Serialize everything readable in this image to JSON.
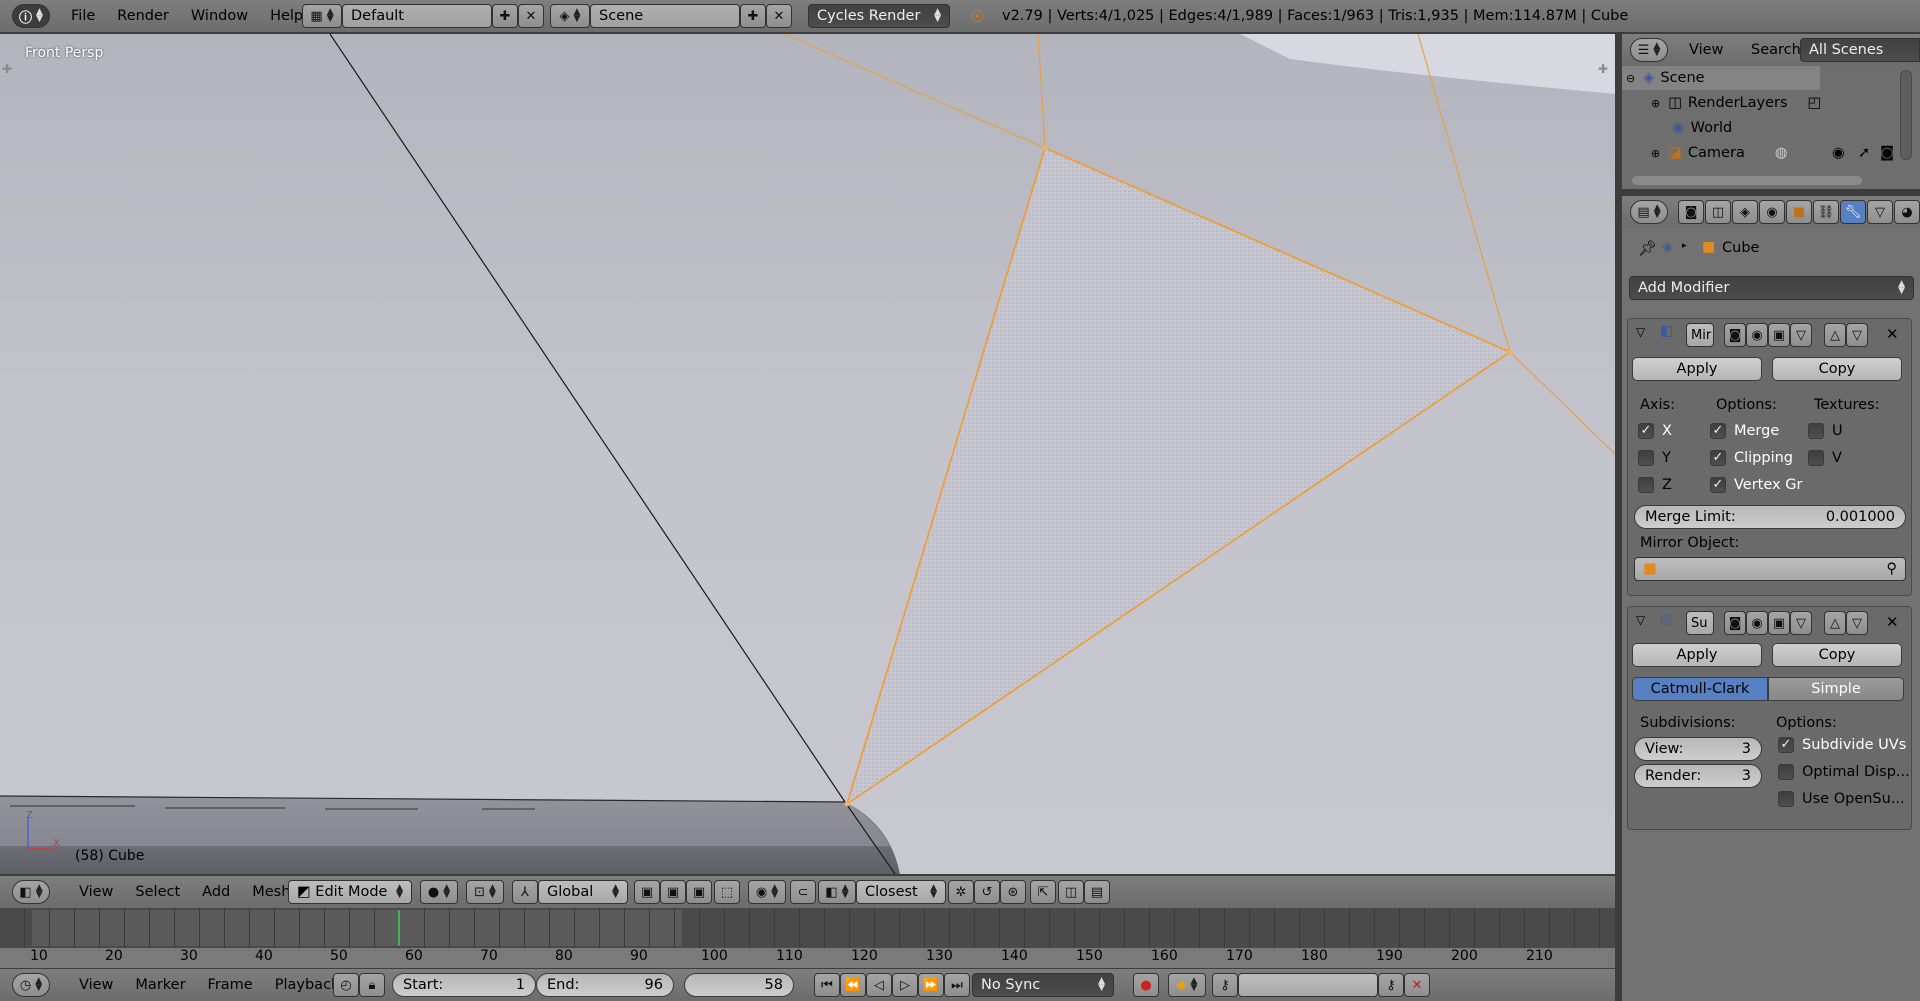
{
  "info_header": {
    "menus": [
      "File",
      "Render",
      "Window",
      "Help"
    ],
    "screen_layout": "Default",
    "scene": "Scene",
    "render_engine": "Cycles Render",
    "stats": "v2.79 | Verts:4/1,025 | Edges:4/1,989 | Faces:1/963 | Tris:1,935 | Mem:114.87M | Cube"
  },
  "viewport": {
    "view_label": "Front Persp",
    "object_label": "(58) Cube",
    "axis_z": "Z",
    "axis_x": "X"
  },
  "view3d_header": {
    "menus": [
      "View",
      "Select",
      "Add",
      "Mesh"
    ],
    "mode": "Edit Mode",
    "orientation": "Global",
    "snap_target": "Closest"
  },
  "timeline": {
    "ticks": [
      "10",
      "20",
      "30",
      "40",
      "50",
      "60",
      "70",
      "80",
      "90",
      "100",
      "110",
      "120",
      "130",
      "140",
      "150",
      "160",
      "170",
      "180",
      "190",
      "200",
      "210"
    ],
    "current_frame": 58,
    "menus": [
      "View",
      "Marker",
      "Frame",
      "Playback"
    ],
    "start_label": "Start:",
    "start_value": "1",
    "end_label": "End:",
    "end_value": "96",
    "frame_value": "58",
    "sync": "No Sync"
  },
  "outliner": {
    "menus": [
      "View",
      "Search"
    ],
    "filter": "All Scenes",
    "items": [
      {
        "label": "Scene",
        "icon": "scene-icon"
      },
      {
        "label": "RenderLayers",
        "icon": "renderlayers-icon"
      },
      {
        "label": "World",
        "icon": "world-icon"
      },
      {
        "label": "Camera",
        "icon": "camera-icon"
      }
    ]
  },
  "properties": {
    "breadcrumb_object": "Cube",
    "add_modifier": "Add Modifier",
    "mirror": {
      "name": "Mir",
      "apply": "Apply",
      "copy": "Copy",
      "axis_label": "Axis:",
      "options_label": "Options:",
      "textures_label": "Textures:",
      "axis": [
        {
          "label": "X",
          "checked": true
        },
        {
          "label": "Y",
          "checked": false
        },
        {
          "label": "Z",
          "checked": false
        }
      ],
      "options": [
        {
          "label": "Merge",
          "checked": true
        },
        {
          "label": "Clipping",
          "checked": true
        },
        {
          "label": "Vertex Gr",
          "checked": true
        }
      ],
      "textures": [
        {
          "label": "U",
          "checked": false
        },
        {
          "label": "V",
          "checked": false
        }
      ],
      "merge_limit_label": "Merge Limit:",
      "merge_limit_value": "0.001000",
      "mirror_object_label": "Mirror Object:"
    },
    "subsurf": {
      "name": "Su",
      "apply": "Apply",
      "copy": "Copy",
      "catmull": "Catmull-Clark",
      "simple": "Simple",
      "subdivisions_label": "Subdivisions:",
      "view_label": "View:",
      "view_value": "3",
      "render_label": "Render:",
      "render_value": "3",
      "options_label": "Options:",
      "options": [
        {
          "label": "Subdivide UVs",
          "checked": true
        },
        {
          "label": "Optimal Disp...",
          "checked": false
        },
        {
          "label": "Use OpenSu...",
          "checked": false
        }
      ]
    }
  },
  "colors": {
    "selection": "#f29a2e",
    "accent_blue": "#5680c2",
    "frame_indicator": "#3fb34f"
  }
}
